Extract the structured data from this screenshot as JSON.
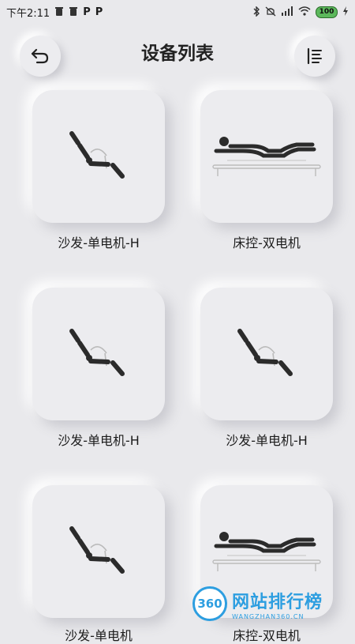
{
  "status_bar": {
    "time": "下午2:11",
    "left_icons": [
      "trash-icon",
      "trash-icon",
      "parking-icon",
      "parking-icon"
    ],
    "right_icons": [
      "bluetooth-icon",
      "mute-icon",
      "signal-icon",
      "wifi-icon",
      "battery-icon",
      "charging-icon"
    ],
    "battery": "100"
  },
  "header": {
    "title": "设备列表",
    "back_icon": "back-arrow-icon",
    "menu_icon": "list-icon"
  },
  "devices": [
    {
      "label": "沙发-单电机-H",
      "icon": "sofa-recliner-icon"
    },
    {
      "label": "床控-双电机",
      "icon": "bed-adjustable-icon"
    },
    {
      "label": "沙发-单电机-H",
      "icon": "sofa-recliner-icon"
    },
    {
      "label": "沙发-单电机-H",
      "icon": "sofa-recliner-icon"
    },
    {
      "label": "沙发-单电机",
      "icon": "sofa-recliner-icon"
    },
    {
      "label": "床控-双电机",
      "icon": "bed-adjustable-icon"
    }
  ],
  "watermark": {
    "logo": "360",
    "main": "网站排行榜",
    "sub": "WANGZHAN360.CN"
  },
  "colors": {
    "background": "#e9e9ec",
    "card": "#ececef",
    "icon": "#2b2b2b",
    "watermark": "#2d9ee0"
  }
}
